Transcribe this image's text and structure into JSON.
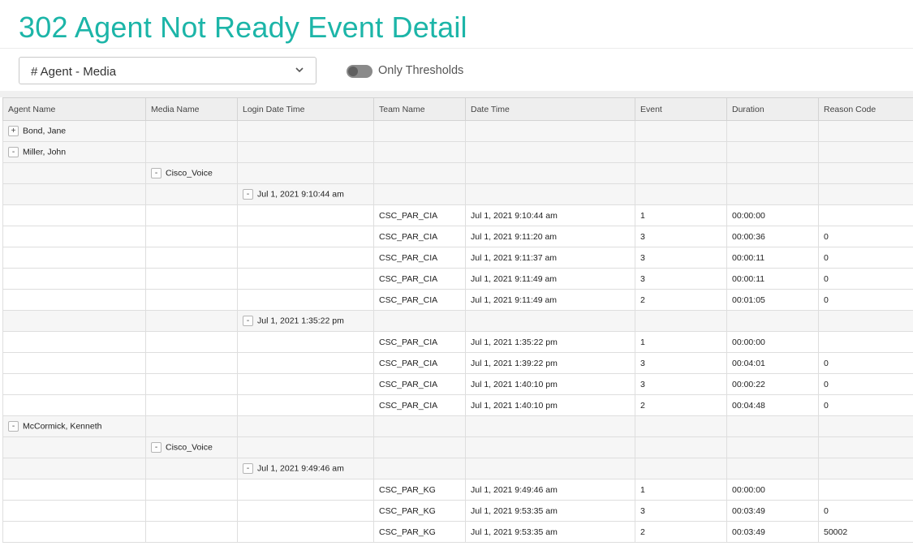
{
  "title": "302 Agent Not Ready Event Detail",
  "grouping_select": {
    "value": "# Agent - Media"
  },
  "threshold_toggle": {
    "label": "Only Thresholds",
    "on": false
  },
  "grid": {
    "columns": [
      "Agent Name",
      "Media Name",
      "Login Date Time",
      "Team Name",
      "Date Time",
      "Event",
      "Duration",
      "Reason Code"
    ],
    "rows": [
      {
        "kind": "agent",
        "expander": "+",
        "label": "Bond, Jane"
      },
      {
        "kind": "agent",
        "expander": "-",
        "label": "Miller, John"
      },
      {
        "kind": "media",
        "expander": "-",
        "label": "Cisco_Voice"
      },
      {
        "kind": "login",
        "expander": "-",
        "label": "Jul 1, 2021 9:10:44 am"
      },
      {
        "kind": "detail",
        "team": "CSC_PAR_CIA",
        "datetime": "Jul 1, 2021 9:10:44 am",
        "event": "1",
        "duration": "00:00:00",
        "reason": ""
      },
      {
        "kind": "detail",
        "team": "CSC_PAR_CIA",
        "datetime": "Jul 1, 2021 9:11:20 am",
        "event": "3",
        "duration": "00:00:36",
        "reason": "0"
      },
      {
        "kind": "detail",
        "team": "CSC_PAR_CIA",
        "datetime": "Jul 1, 2021 9:11:37 am",
        "event": "3",
        "duration": "00:00:11",
        "reason": "0"
      },
      {
        "kind": "detail",
        "team": "CSC_PAR_CIA",
        "datetime": "Jul 1, 2021 9:11:49 am",
        "event": "3",
        "duration": "00:00:11",
        "reason": "0"
      },
      {
        "kind": "detail",
        "team": "CSC_PAR_CIA",
        "datetime": "Jul 1, 2021 9:11:49 am",
        "event": "2",
        "duration": "00:01:05",
        "reason": "0"
      },
      {
        "kind": "login",
        "expander": "-",
        "label": "Jul 1, 2021 1:35:22 pm"
      },
      {
        "kind": "detail",
        "team": "CSC_PAR_CIA",
        "datetime": "Jul 1, 2021 1:35:22 pm",
        "event": "1",
        "duration": "00:00:00",
        "reason": ""
      },
      {
        "kind": "detail",
        "team": "CSC_PAR_CIA",
        "datetime": "Jul 1, 2021 1:39:22 pm",
        "event": "3",
        "duration": "00:04:01",
        "reason": "0"
      },
      {
        "kind": "detail",
        "team": "CSC_PAR_CIA",
        "datetime": "Jul 1, 2021 1:40:10 pm",
        "event": "3",
        "duration": "00:00:22",
        "reason": "0"
      },
      {
        "kind": "detail",
        "team": "CSC_PAR_CIA",
        "datetime": "Jul 1, 2021 1:40:10 pm",
        "event": "2",
        "duration": "00:04:48",
        "reason": "0"
      },
      {
        "kind": "agent",
        "expander": "-",
        "label": "McCormick, Kenneth"
      },
      {
        "kind": "media",
        "expander": "-",
        "label": "Cisco_Voice"
      },
      {
        "kind": "login",
        "expander": "-",
        "label": "Jul 1, 2021 9:49:46 am"
      },
      {
        "kind": "detail",
        "team": "CSC_PAR_KG",
        "datetime": "Jul 1, 2021 9:49:46 am",
        "event": "1",
        "duration": "00:00:00",
        "reason": ""
      },
      {
        "kind": "detail",
        "team": "CSC_PAR_KG",
        "datetime": "Jul 1, 2021 9:53:35 am",
        "event": "3",
        "duration": "00:03:49",
        "reason": "0"
      },
      {
        "kind": "detail",
        "team": "CSC_PAR_KG",
        "datetime": "Jul 1, 2021 9:53:35 am",
        "event": "2",
        "duration": "00:03:49",
        "reason": "50002"
      }
    ]
  }
}
